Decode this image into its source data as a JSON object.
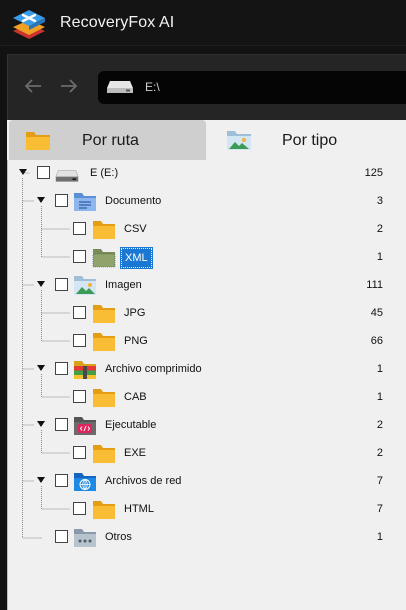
{
  "app": {
    "title": "RecoveryFox AI"
  },
  "nav": {
    "path": "E:\\"
  },
  "tabs": [
    {
      "label": "Por ruta",
      "icon": "folder-icon",
      "active": false
    },
    {
      "label": "Por tipo",
      "icon": "image-folder-icon",
      "active": true
    }
  ],
  "tree": [
    {
      "label": "E (E:)",
      "count": "125",
      "level": 0,
      "icon": "drive-icon",
      "expanded": true
    },
    {
      "label": "Documento",
      "count": "3",
      "level": 1,
      "icon": "document-folder-icon",
      "expanded": true
    },
    {
      "label": "CSV",
      "count": "2",
      "level": 2,
      "icon": "folder-icon"
    },
    {
      "label": "XML",
      "count": "1",
      "level": 2,
      "icon": "folder-icon",
      "selected": true
    },
    {
      "label": "Imagen",
      "count": "111",
      "level": 1,
      "icon": "image-folder-icon",
      "expanded": true
    },
    {
      "label": "JPG",
      "count": "45",
      "level": 2,
      "icon": "folder-icon"
    },
    {
      "label": "PNG",
      "count": "66",
      "level": 2,
      "icon": "folder-icon"
    },
    {
      "label": "Archivo comprimido",
      "count": "1",
      "level": 1,
      "icon": "archive-folder-icon",
      "expanded": true
    },
    {
      "label": "CAB",
      "count": "1",
      "level": 2,
      "icon": "folder-icon"
    },
    {
      "label": "Ejecutable",
      "count": "2",
      "level": 1,
      "icon": "executable-folder-icon",
      "expanded": true
    },
    {
      "label": "EXE",
      "count": "2",
      "level": 2,
      "icon": "folder-icon"
    },
    {
      "label": "Archivos de red",
      "count": "7",
      "level": 1,
      "icon": "web-folder-icon",
      "expanded": true
    },
    {
      "label": "HTML",
      "count": "7",
      "level": 2,
      "icon": "folder-icon"
    },
    {
      "label": "Otros",
      "count": "1",
      "level": 1,
      "icon": "other-folder-icon",
      "expanded": false
    }
  ],
  "colors": {
    "accent": "#1a78d4",
    "folder": "#f7b324",
    "titlebar": "#141414",
    "panel": "#f0f0f0"
  }
}
